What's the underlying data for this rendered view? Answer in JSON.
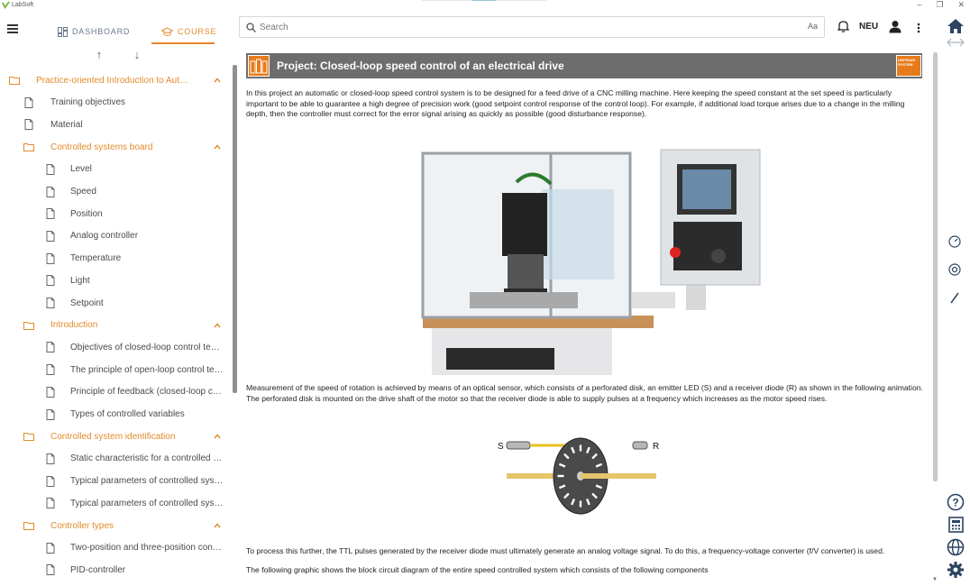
{
  "window": {
    "app_title": "LabSoft"
  },
  "sidebar": {
    "tabs": {
      "dashboard": "DASHBOARD",
      "course": "COURSE"
    },
    "tree": [
      {
        "type": "folder",
        "label": "Practice-oriented Introduction to Auto..."
      },
      {
        "type": "page",
        "label": "Training objectives"
      },
      {
        "type": "page",
        "label": "Material"
      },
      {
        "type": "folder",
        "label": "Controlled systems board"
      },
      {
        "type": "page",
        "label": "Level"
      },
      {
        "type": "page",
        "label": "Speed"
      },
      {
        "type": "page",
        "label": "Position"
      },
      {
        "type": "page",
        "label": "Analog controller"
      },
      {
        "type": "page",
        "label": "Temperature"
      },
      {
        "type": "page",
        "label": "Light"
      },
      {
        "type": "page",
        "label": "Setpoint"
      },
      {
        "type": "folder",
        "label": "Introduction"
      },
      {
        "type": "page",
        "label": "Objectives of closed-loop control tech..."
      },
      {
        "type": "page",
        "label": "The principle of open-loop control tec..."
      },
      {
        "type": "page",
        "label": "Principle of feedback (closed-loop con..."
      },
      {
        "type": "page",
        "label": "Types of controlled variables"
      },
      {
        "type": "folder",
        "label": "Controlled system identification"
      },
      {
        "type": "page",
        "label": "Static characteristic for a controlled s..."
      },
      {
        "type": "page",
        "label": "Typical parameters of controlled syst..."
      },
      {
        "type": "page",
        "label": "Typical parameters of controlled syst..."
      },
      {
        "type": "folder",
        "label": "Controller types"
      },
      {
        "type": "page",
        "label": "Two-position and three-position contr..."
      },
      {
        "type": "page",
        "label": "PID-controller"
      }
    ]
  },
  "topbar": {
    "search_placeholder": "Search",
    "font_toggle": "Aa",
    "language": "NEU"
  },
  "content": {
    "title": "Project: Closed-loop speed control of an electrical drive",
    "brand_logo_text": "UNITRAIN SYSTEM",
    "paragraphs": [
      "In this project an automatic or closed-loop speed control system is to be designed for a feed drive of a CNC milling machine. Here keeping the speed constant at the set speed is particularly important to be able to guarantee a high degree of precision work (good setpoint control response of the control loop). For example, if additional load torque arises due to a change in the milling depth, then the controller must correct for the error signal arising as quickly as possible (good disturbance response).",
      "Measurement of the speed of rotation is achieved by means of an optical sensor, which consists of a perforated disk, an emitter LED (S) and a receiver diode (R) as shown in the following animation. The perforated disk is mounted on the drive shaft of the motor so that the receiver diode is able to supply pulses at a frequency which increases as the motor speed rises.",
      "To process this further, the TTL pulses generated by the receiver diode must ultimately generate an analog voltage signal. To do this, a frequency-voltage converter (f/V converter) is used.",
      "The following graphic shows the block circuit diagram of the entire speed controlled system which consists of the following components"
    ],
    "sensor_labels": {
      "emitter": "S",
      "receiver": "R"
    }
  },
  "colors": {
    "accent": "#e38b2b",
    "banner": "#6d6d6d",
    "brand": "#e77b1c",
    "nav_gray": "#6c7a8c"
  },
  "icons": {
    "rail": [
      "home-icon",
      "swap-arrows-icon",
      "speedometer-icon",
      "chip-icon",
      "pen-icon",
      "help-icon",
      "calculator-icon",
      "globe-icon",
      "settings-icon"
    ],
    "topbar": [
      "search-icon",
      "bell-icon",
      "user-icon",
      "more-vert-icon"
    ]
  }
}
